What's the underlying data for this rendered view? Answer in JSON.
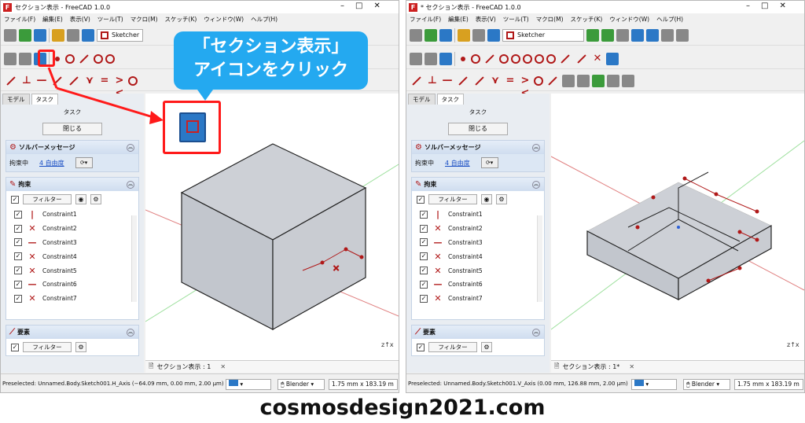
{
  "left_window": {
    "title": "セクション表示 - FreeCAD 1.0.0",
    "menus": [
      "ファイル(F)",
      "編集(E)",
      "表示(V)",
      "ツール(T)",
      "マクロ(M)",
      "スケッチ(K)",
      "ウィンドウ(W)",
      "ヘルプ(H)"
    ],
    "workbench": "Sketcher",
    "tabs": [
      "モデル",
      "タスク"
    ],
    "task_label": "タスク",
    "close_button": "閉じる",
    "solver_title": "ソルバーメッセージ",
    "solver_status": "拘束中",
    "solver_dof": "4 自由度",
    "constraints_title": "拘束",
    "filter_label": "フィルター",
    "constraints": [
      "Constraint1",
      "Constraint2",
      "Constraint3",
      "Constraint4",
      "Constraint5",
      "Constraint6",
      "Constraint7"
    ],
    "elements_title": "要素",
    "view_tab": "セクション表示 : 1",
    "status_text": "Preselected: Unnamed.Body.Sketch001.H_Axis (−64.09 mm, 0.00 mm, 2.00 µm)",
    "nav_style": "Blender",
    "dims": "1.75 mm x 183.19 m"
  },
  "right_window": {
    "title": "* セクション表示 - FreeCAD 1.0.0",
    "menus": [
      "ファイル(F)",
      "編集(E)",
      "表示(V)",
      "ツール(T)",
      "マクロ(M)",
      "スケッチ(K)",
      "ウィンドウ(W)",
      "ヘルプ(H)"
    ],
    "workbench": "Sketcher",
    "tabs": [
      "モデル",
      "タスク"
    ],
    "task_label": "タスク",
    "close_button": "閉じる",
    "solver_title": "ソルバーメッセージ",
    "solver_status": "拘束中",
    "solver_dof": "4 自由度",
    "constraints_title": "拘束",
    "filter_label": "フィルター",
    "constraints": [
      "Constraint1",
      "Constraint2",
      "Constraint3",
      "Constraint4",
      "Constraint5",
      "Constraint6",
      "Constraint7"
    ],
    "elements_title": "要素",
    "view_tab": "セクション表示 : 1*",
    "status_text": "Preselected: Unnamed.Body.Sketch001.V_Axis (0.00 mm, 126.88 mm, 2.00 µm)",
    "nav_style": "Blender",
    "dims": "1.75 mm x 183.19 m"
  },
  "callout": {
    "line1": "「セクション表示」",
    "line2": "アイコンをクリック"
  },
  "footer": "cosmosdesign2021.com",
  "colors": {
    "accent_blue": "#24a9f0",
    "highlight_red": "#ff1a1a",
    "constraint_red": "#b01818",
    "solid_face": "#c8ccd3"
  }
}
